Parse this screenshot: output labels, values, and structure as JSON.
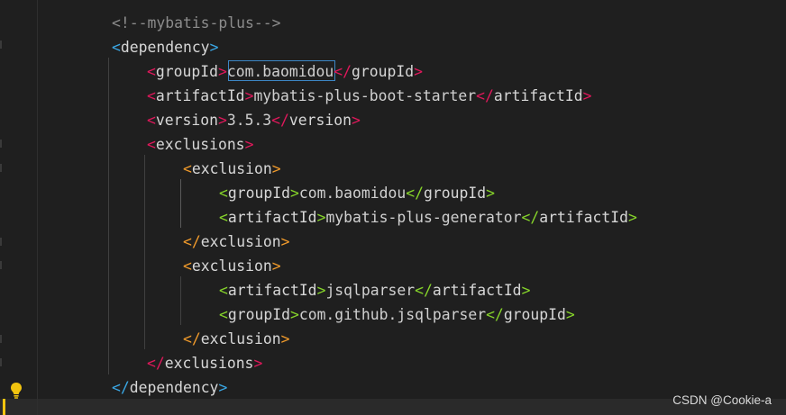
{
  "colors": {
    "background": "#1f1f1f",
    "tag_pink": "#e0185b",
    "tag_orange": "#f09a2b",
    "tag_green": "#86d42a",
    "tag_blue": "#3aa8e6",
    "tag_name": "#d7d7d7",
    "text": "#d0d0d0",
    "comment": "#8c8c8c"
  },
  "watermark": "CSDN @Cookie-a",
  "lightbulb_icon": "lightbulb-icon",
  "code": {
    "lines": [
      {
        "indent": 124,
        "segs": [
          {
            "t": "<!--mybatis-plus-->",
            "c": "comment"
          }
        ]
      },
      {
        "indent": 124,
        "segs": [
          {
            "t": "<",
            "c": "tag_blue"
          },
          {
            "t": "dependency",
            "c": "tag_name"
          },
          {
            "t": ">",
            "c": "tag_blue"
          }
        ]
      },
      {
        "indent": 163,
        "segs": [
          {
            "t": "<",
            "c": "tag_pink"
          },
          {
            "t": "groupId",
            "c": "tag_name"
          },
          {
            "t": ">",
            "c": "tag_pink"
          },
          {
            "t": "com.baomidou",
            "c": "text"
          },
          {
            "t": "</",
            "c": "tag_pink"
          },
          {
            "t": "groupId",
            "c": "tag_name"
          },
          {
            "t": ">",
            "c": "tag_pink"
          }
        ]
      },
      {
        "indent": 163,
        "segs": [
          {
            "t": "<",
            "c": "tag_pink"
          },
          {
            "t": "artifactId",
            "c": "tag_name"
          },
          {
            "t": ">",
            "c": "tag_pink"
          },
          {
            "t": "mybatis-plus-boot-starter",
            "c": "text"
          },
          {
            "t": "</",
            "c": "tag_pink"
          },
          {
            "t": "artifactId",
            "c": "tag_name"
          },
          {
            "t": ">",
            "c": "tag_pink"
          }
        ]
      },
      {
        "indent": 163,
        "segs": [
          {
            "t": "<",
            "c": "tag_pink"
          },
          {
            "t": "version",
            "c": "tag_name"
          },
          {
            "t": ">",
            "c": "tag_pink"
          },
          {
            "t": "3.5.3",
            "c": "text"
          },
          {
            "t": "</",
            "c": "tag_pink"
          },
          {
            "t": "version",
            "c": "tag_name"
          },
          {
            "t": ">",
            "c": "tag_pink"
          }
        ]
      },
      {
        "indent": 163,
        "segs": [
          {
            "t": "<",
            "c": "tag_pink"
          },
          {
            "t": "exclusions",
            "c": "tag_name"
          },
          {
            "t": ">",
            "c": "tag_pink"
          }
        ]
      },
      {
        "indent": 203,
        "segs": [
          {
            "t": "<",
            "c": "tag_orange"
          },
          {
            "t": "exclusion",
            "c": "tag_name"
          },
          {
            "t": ">",
            "c": "tag_orange"
          }
        ]
      },
      {
        "indent": 243,
        "segs": [
          {
            "t": "<",
            "c": "tag_green"
          },
          {
            "t": "groupId",
            "c": "tag_name"
          },
          {
            "t": ">",
            "c": "tag_green"
          },
          {
            "t": "com.baomidou",
            "c": "text"
          },
          {
            "t": "</",
            "c": "tag_green"
          },
          {
            "t": "groupId",
            "c": "tag_name"
          },
          {
            "t": ">",
            "c": "tag_green"
          }
        ]
      },
      {
        "indent": 243,
        "segs": [
          {
            "t": "<",
            "c": "tag_green"
          },
          {
            "t": "artifactId",
            "c": "tag_name"
          },
          {
            "t": ">",
            "c": "tag_green"
          },
          {
            "t": "mybatis-plus-generator",
            "c": "text"
          },
          {
            "t": "</",
            "c": "tag_green"
          },
          {
            "t": "artifactId",
            "c": "tag_name"
          },
          {
            "t": ">",
            "c": "tag_green"
          }
        ]
      },
      {
        "indent": 203,
        "segs": [
          {
            "t": "</",
            "c": "tag_orange"
          },
          {
            "t": "exclusion",
            "c": "tag_name"
          },
          {
            "t": ">",
            "c": "tag_orange"
          }
        ]
      },
      {
        "indent": 203,
        "segs": [
          {
            "t": "<",
            "c": "tag_orange"
          },
          {
            "t": "exclusion",
            "c": "tag_name"
          },
          {
            "t": ">",
            "c": "tag_orange"
          }
        ]
      },
      {
        "indent": 243,
        "segs": [
          {
            "t": "<",
            "c": "tag_green"
          },
          {
            "t": "artifactId",
            "c": "tag_name"
          },
          {
            "t": ">",
            "c": "tag_green"
          },
          {
            "t": "jsqlparser",
            "c": "text"
          },
          {
            "t": "</",
            "c": "tag_green"
          },
          {
            "t": "artifactId",
            "c": "tag_name"
          },
          {
            "t": ">",
            "c": "tag_green"
          }
        ]
      },
      {
        "indent": 243,
        "segs": [
          {
            "t": "<",
            "c": "tag_green"
          },
          {
            "t": "groupId",
            "c": "tag_name"
          },
          {
            "t": ">",
            "c": "tag_green"
          },
          {
            "t": "com.github.jsqlparser",
            "c": "text"
          },
          {
            "t": "</",
            "c": "tag_green"
          },
          {
            "t": "groupId",
            "c": "tag_name"
          },
          {
            "t": ">",
            "c": "tag_green"
          }
        ]
      },
      {
        "indent": 203,
        "segs": [
          {
            "t": "</",
            "c": "tag_orange"
          },
          {
            "t": "exclusion",
            "c": "tag_name"
          },
          {
            "t": ">",
            "c": "tag_orange"
          }
        ]
      },
      {
        "indent": 163,
        "segs": [
          {
            "t": "</",
            "c": "tag_pink"
          },
          {
            "t": "exclusions",
            "c": "tag_name"
          },
          {
            "t": ">",
            "c": "tag_pink"
          }
        ]
      },
      {
        "indent": 124,
        "segs": [
          {
            "t": "</",
            "c": "tag_blue"
          },
          {
            "t": "dependency",
            "c": "tag_name"
          },
          {
            "t": ">",
            "c": "tag_blue"
          }
        ]
      }
    ]
  }
}
